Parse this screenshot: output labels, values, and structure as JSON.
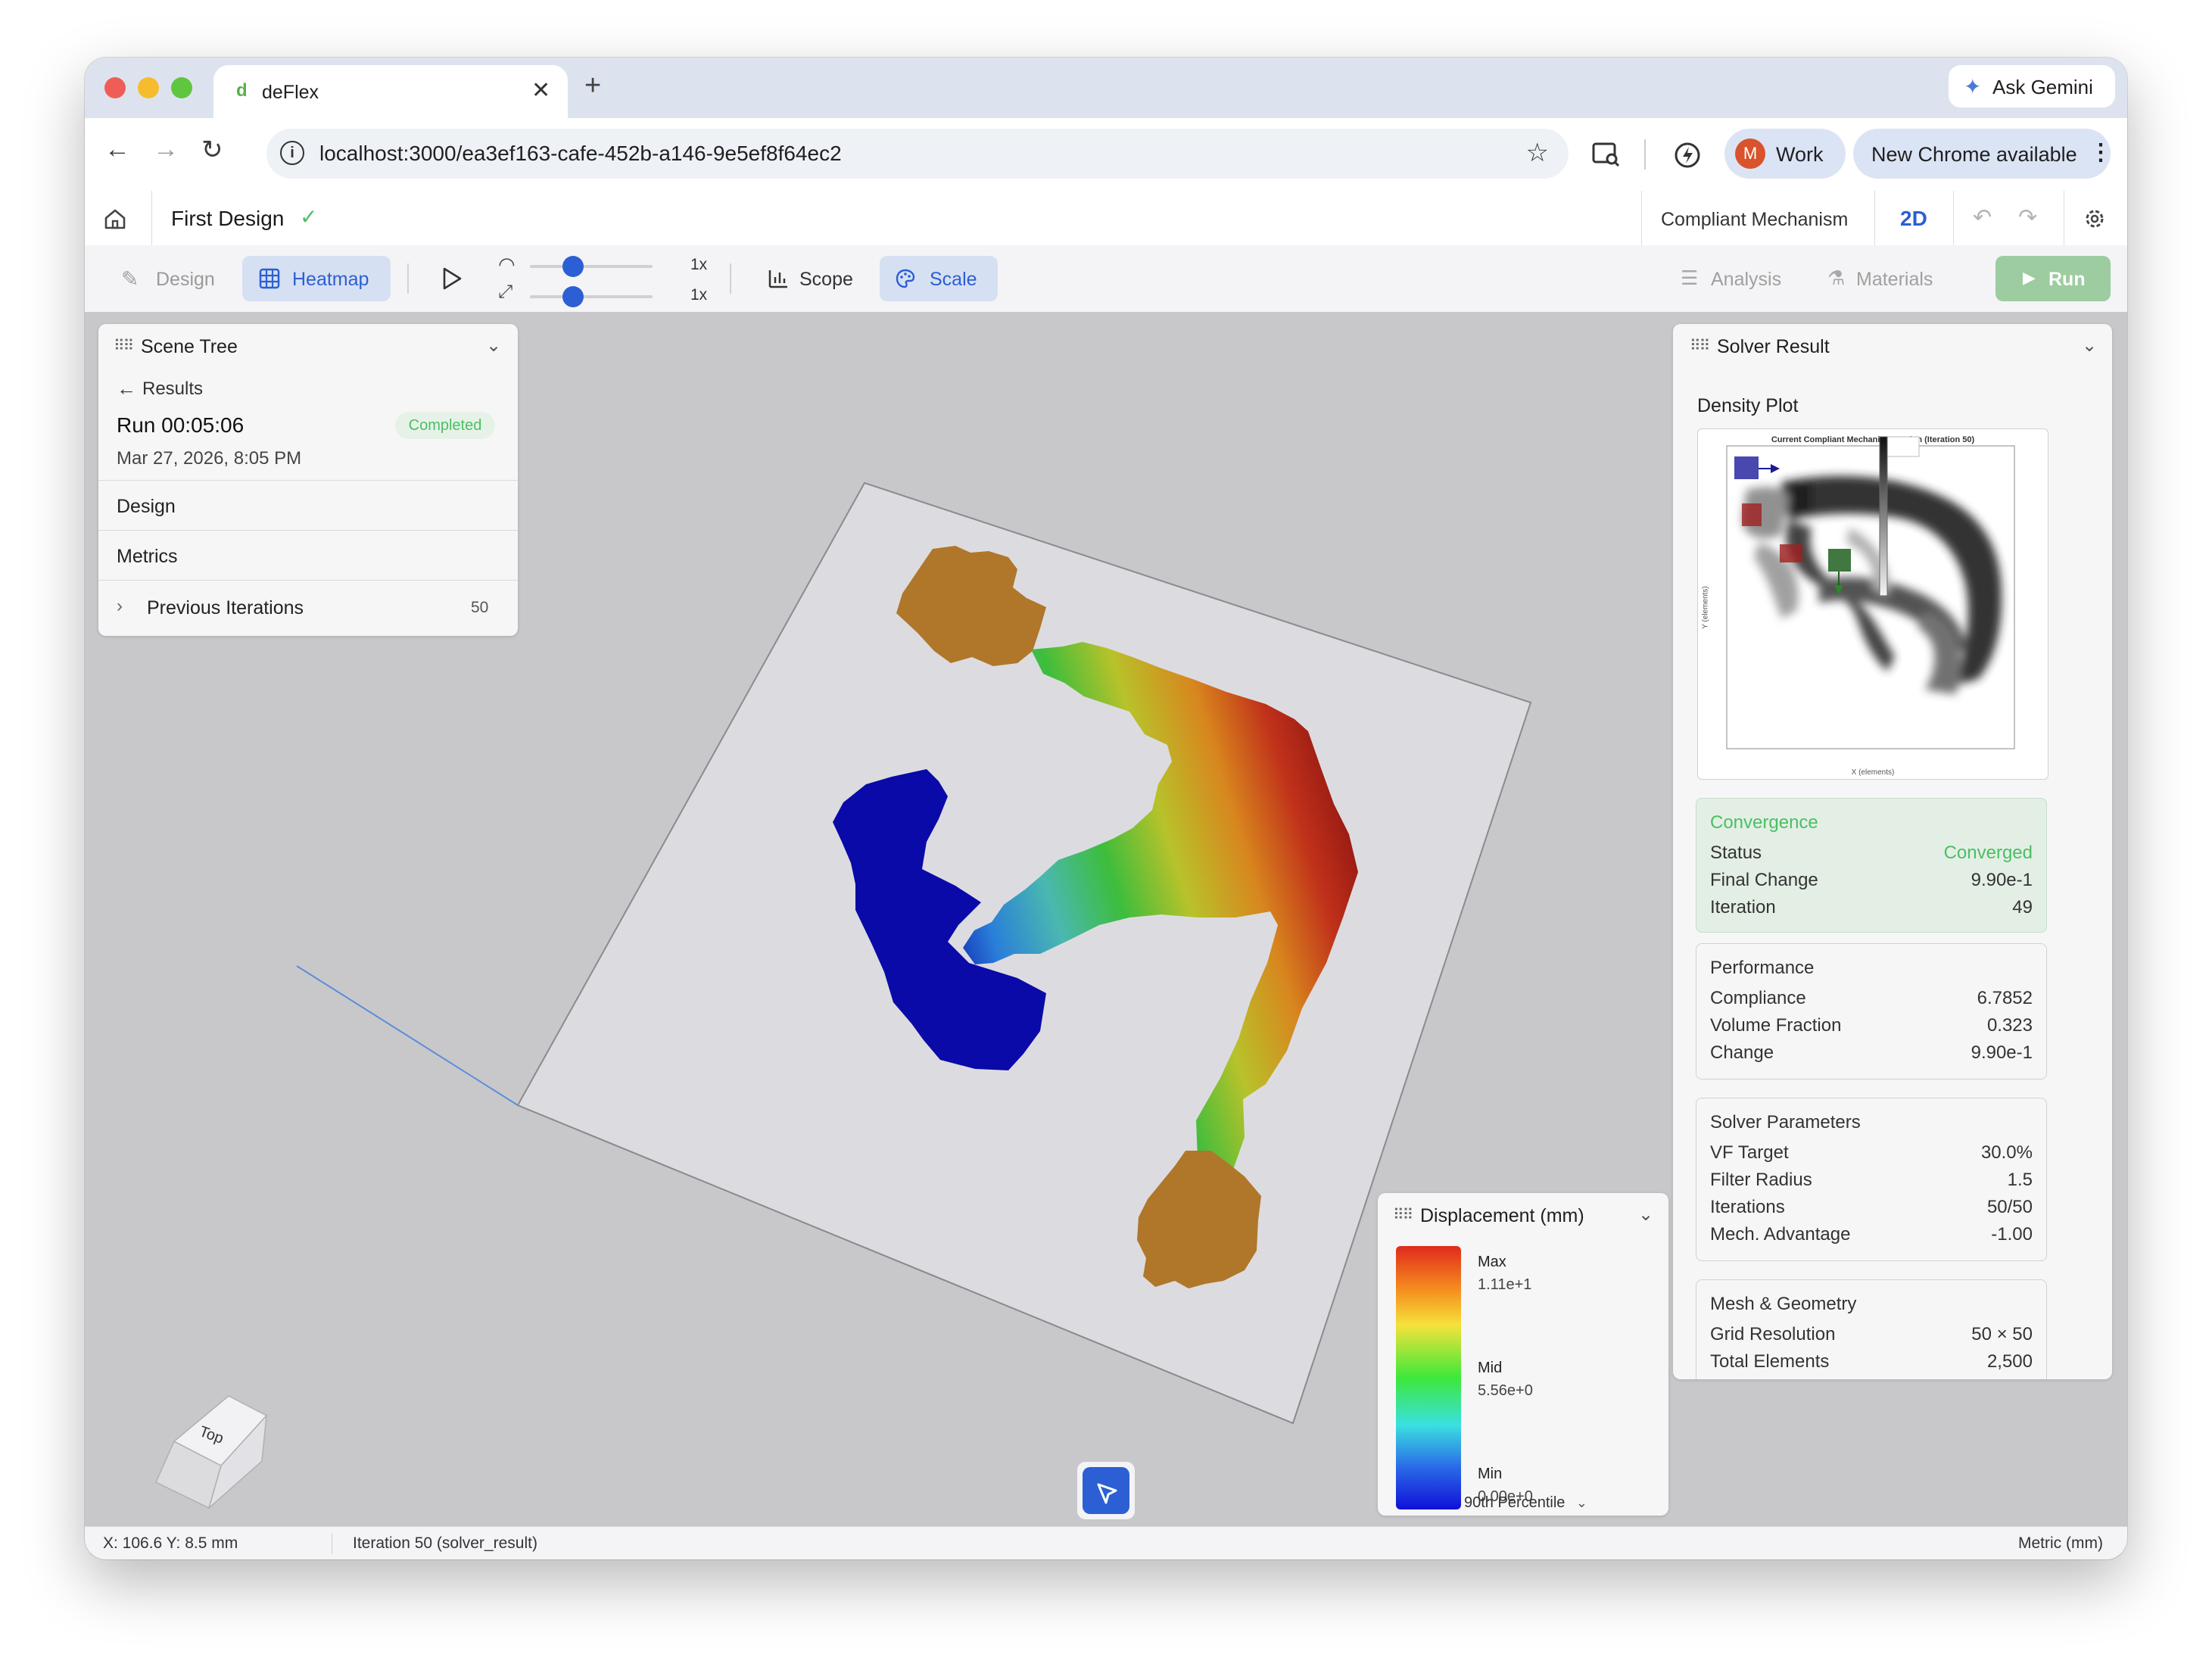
{
  "browser": {
    "tab_title": "deFlex",
    "tab_favicon": "d",
    "ask_gemini": "Ask Gemini",
    "url": "localhost:3000/ea3ef163-cafe-452b-a146-9e5ef8f64ec2",
    "profile_initial": "M",
    "profile_label": "Work",
    "update_label": "New Chrome available"
  },
  "app": {
    "design_title": "First Design",
    "mode_label": "Compliant Mechanism",
    "view_mode": "2D"
  },
  "toolbar": {
    "design": "Design",
    "heatmap": "Heatmap",
    "speed_value": "1x",
    "scale_value": "1x",
    "speed_level": 0.35,
    "scale_level": 0.35,
    "scope": "Scope",
    "scale": "Scale",
    "analysis": "Analysis",
    "materials": "Materials",
    "run": "Run"
  },
  "scene_tree": {
    "title": "Scene Tree",
    "back_label": "Results",
    "run_title": "Run 00:05:06",
    "run_status": "Completed",
    "run_date": "Mar 27, 2026, 8:05 PM",
    "design": "Design",
    "metrics": "Metrics",
    "previous_iterations": "Previous Iterations",
    "previous_iterations_count": "50"
  },
  "solver_result": {
    "title": "Solver Result",
    "density_plot_label": "Density Plot",
    "density_plot_caption": "Current Compliant Mechanism Design (Iteration 50)",
    "density_plot_xlabel": "X (elements)",
    "density_plot_ylabel": "Y (elements)",
    "convergence": {
      "heading": "Convergence",
      "status_label": "Status",
      "status_value": "Converged",
      "final_change_label": "Final Change",
      "final_change_value": "9.90e-1",
      "iteration_label": "Iteration",
      "iteration_value": "49"
    },
    "performance": {
      "heading": "Performance",
      "compliance_label": "Compliance",
      "compliance_value": "6.7852",
      "volume_fraction_label": "Volume Fraction",
      "volume_fraction_value": "0.323",
      "change_label": "Change",
      "change_value": "9.90e-1"
    },
    "solver_parameters": {
      "heading": "Solver Parameters",
      "vf_target_label": "VF Target",
      "vf_target_value": "30.0%",
      "filter_radius_label": "Filter Radius",
      "filter_radius_value": "1.5",
      "iterations_label": "Iterations",
      "iterations_value": "50/50",
      "mech_advantage_label": "Mech. Advantage",
      "mech_advantage_value": "-1.00"
    },
    "mesh_geometry": {
      "heading": "Mesh & Geometry",
      "grid_resolution_label": "Grid Resolution",
      "grid_resolution_value": "50 × 50",
      "total_elements_label": "Total Elements",
      "total_elements_value": "2,500"
    }
  },
  "legend": {
    "title": "Displacement (mm)",
    "max_label": "Max",
    "max_value": "1.11e+1",
    "mid_label": "Mid",
    "mid_value": "5.56e+0",
    "min_label": "Min",
    "min_value": "0.00e+0",
    "percentile": "90th Percentile"
  },
  "view_cube": {
    "face_label": "Top"
  },
  "status_bar": {
    "coordinates": "X: 106.6 Y: 8.5 mm",
    "iteration": "Iteration 50 (solver_result)",
    "units": "Metric (mm)"
  },
  "colors": {
    "accent": "#2c5fd3",
    "active_button_bg": "#d6e0f3",
    "run_button": "#9ccca0",
    "converged_green": "#4bbf63",
    "convergence_bg": "#e3efe5",
    "heat_max": "#a01d12",
    "heat_min": "#00009a",
    "anchor_brown": "#b0772a"
  }
}
